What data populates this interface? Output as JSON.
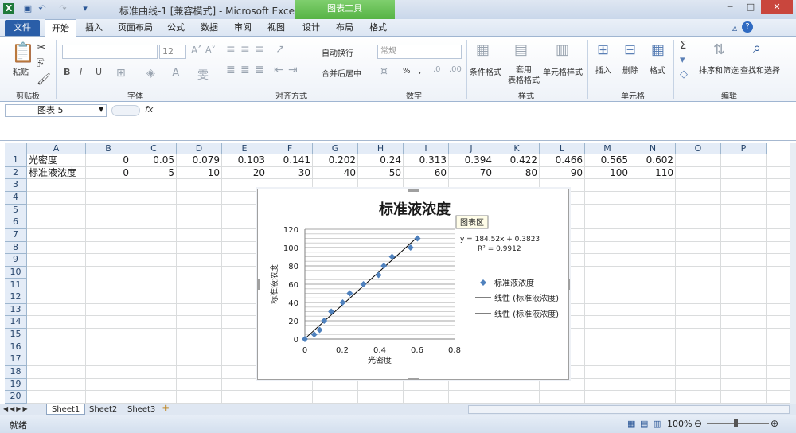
{
  "window": {
    "title": "标准曲线-1  [兼容模式]  -  Microsoft Excel",
    "context_tab": "图表工具",
    "controls": [
      "─",
      "□",
      "✕"
    ]
  },
  "ribbon_tabs": [
    "文件",
    "开始",
    "插入",
    "页面布局",
    "公式",
    "数据",
    "审阅",
    "视图",
    "设计",
    "布局",
    "格式"
  ],
  "ribbon": {
    "clipboard": {
      "paste": "粘贴",
      "group": "剪贴板"
    },
    "font": {
      "size": "12",
      "group": "字体",
      "bold": "B",
      "italic": "I",
      "underline": "U"
    },
    "alignment": {
      "wrap": "自动换行",
      "merge": "合并后居中",
      "group": "对齐方式"
    },
    "number": {
      "format": "常规",
      "percent": "%",
      "comma": ",",
      "group": "数字"
    },
    "styles": {
      "cond": "条件格式",
      "table": "套用\n表格格式",
      "cell": "单元格样式",
      "group": "样式"
    },
    "cells": {
      "insert": "插入",
      "delete": "删除",
      "format": "格式",
      "group": "单元格"
    },
    "editing": {
      "sort": "排序和筛选",
      "find": "查找和选择",
      "group": "编辑"
    }
  },
  "formula_bar": {
    "name_box": "图表 5",
    "fx": "fx",
    "value": ""
  },
  "columns": [
    "A",
    "B",
    "C",
    "D",
    "E",
    "F",
    "G",
    "H",
    "I",
    "J",
    "K",
    "L",
    "M",
    "N",
    "O",
    "P"
  ],
  "rows": [
    "1",
    "2",
    "3",
    "4",
    "5",
    "6",
    "7",
    "8",
    "9",
    "10",
    "11",
    "12",
    "13",
    "14",
    "15",
    "16",
    "17",
    "18",
    "19",
    "20"
  ],
  "cells": {
    "A1": "光密度",
    "B1": "0",
    "C1": "0.05",
    "D1": "0.079",
    "E1": "0.103",
    "F1": "0.141",
    "G1": "0.202",
    "H1": "0.24",
    "I1": "0.313",
    "J1": "0.394",
    "K1": "0.422",
    "L1": "0.466",
    "M1": "0.565",
    "N1": "0.602",
    "A2": "标准液浓度",
    "B2": "0",
    "C2": "5",
    "D2": "10",
    "E2": "20",
    "F2": "30",
    "G2": "40",
    "H2": "50",
    "I2": "60",
    "J2": "70",
    "K2": "80",
    "L2": "90",
    "M2": "100",
    "N2": "110"
  },
  "sheets": [
    "Sheet1",
    "Sheet2",
    "Sheet3"
  ],
  "status": {
    "ready": "就绪",
    "zoom": "100%"
  },
  "chart_tooltip": "图表区",
  "chart_data": {
    "type": "scatter",
    "title": "标准液浓度",
    "xlabel": "光密度",
    "ylabel": "标准液浓度",
    "xlim": [
      0,
      0.8
    ],
    "ylim": [
      0,
      120
    ],
    "xticks": [
      "0",
      "0.2",
      "0.4",
      "0.6",
      "0.8"
    ],
    "yticks": [
      "0",
      "20",
      "40",
      "60",
      "80",
      "100",
      "120"
    ],
    "grid": "horizontal",
    "legend_position": "right",
    "series": [
      {
        "name": "标准液浓度",
        "x": [
          0,
          0.05,
          0.079,
          0.103,
          0.141,
          0.202,
          0.24,
          0.313,
          0.394,
          0.422,
          0.466,
          0.565,
          0.602
        ],
        "y": [
          0,
          5,
          10,
          20,
          30,
          40,
          50,
          60,
          70,
          80,
          90,
          100,
          110
        ],
        "color": "#4f81bd"
      }
    ],
    "trendline": {
      "slope": 184.52,
      "intercept": 0.3823,
      "color": "#000000"
    },
    "annotations": [
      "y = 184.52x + 0.3823",
      "R² = 0.9912"
    ],
    "legend": [
      "标准液浓度",
      "线性 (标准液浓度)",
      "线性 (标准液浓度)"
    ]
  }
}
